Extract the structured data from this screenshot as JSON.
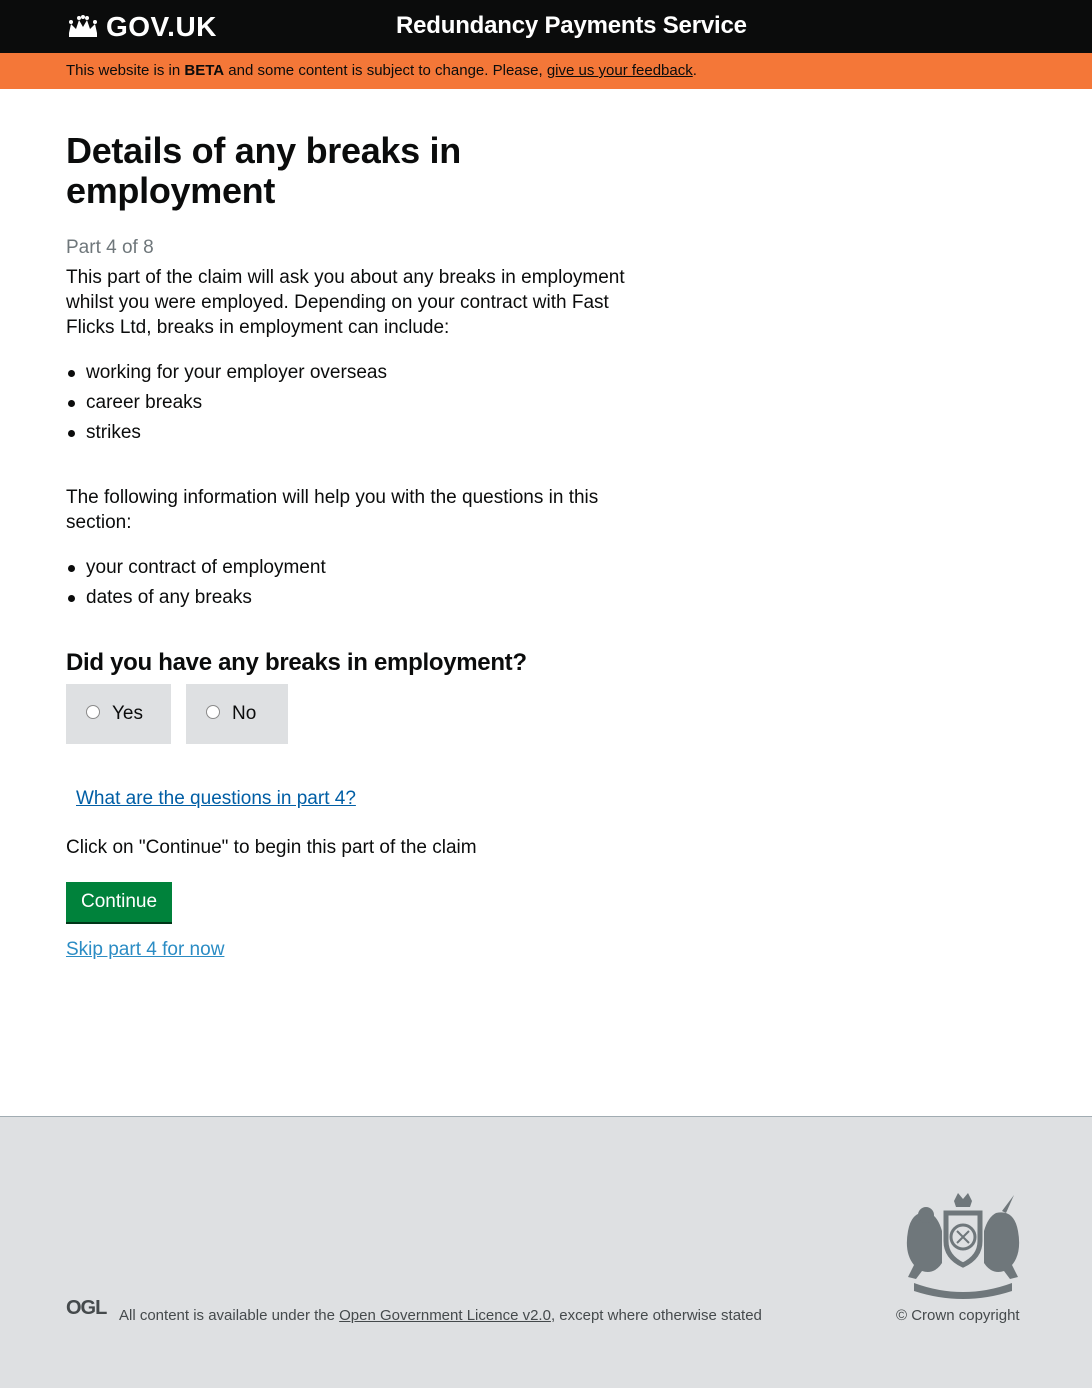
{
  "header": {
    "logo_text": "GOV.UK",
    "service_name": "Redundancy Payments Service"
  },
  "beta_banner": {
    "prefix": "This website is in ",
    "tag": "BETA",
    "middle": " and some content is subject to change. Please, ",
    "feedback_link": "give us your feedback",
    "suffix": "."
  },
  "main": {
    "title": "Details of any breaks in employment",
    "part_label": "Part 4 of 8",
    "intro": "This part of the claim will ask you about any breaks in employment whilst you were employed. Depending on your contract with Fast Flicks Ltd, breaks in employment can include:",
    "break_types": [
      "working for your employer overseas",
      "career breaks",
      "strikes"
    ],
    "info_intro": "The following information will help you with the questions in this section:",
    "info_items": [
      "your contract of employment",
      "dates of any breaks"
    ],
    "question": "Did you have any breaks in employment?",
    "options": [
      "Yes",
      "No"
    ],
    "questions_link": "What are the questions in part 4?",
    "instruction": "Click on \"Continue\" to begin this part of the claim",
    "continue_label": "Continue",
    "skip_link": "Skip part 4 for now"
  },
  "footer": {
    "ogl_logo": "OGL",
    "licence_prefix": "All content is available under the ",
    "licence_link": "Open Government Licence v2.0",
    "licence_suffix": ", except where otherwise stated",
    "copyright": "© Crown copyright"
  },
  "colors": {
    "header_bg": "#0b0c0c",
    "beta_bg": "#f47738",
    "link": "#005ea5",
    "button": "#00823b",
    "footer_bg": "#dee0e2"
  }
}
